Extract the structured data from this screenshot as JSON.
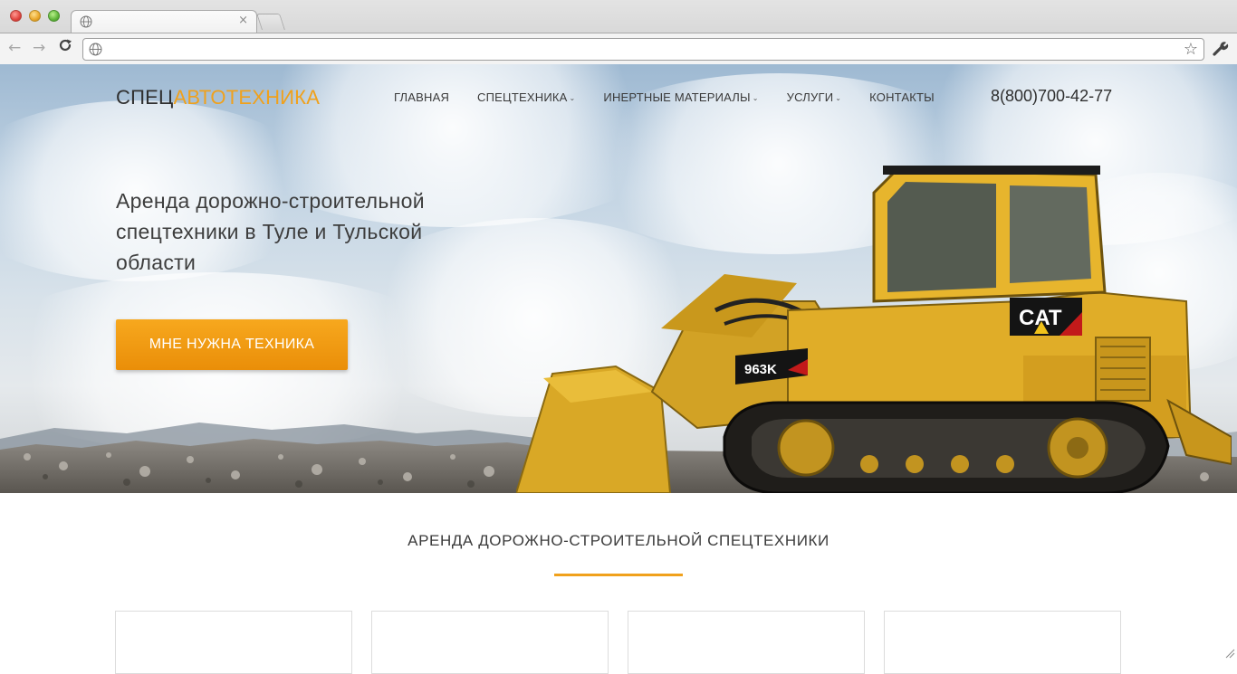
{
  "browser": {
    "tab_close": "×",
    "url_value": "",
    "back": "←",
    "forward": "→",
    "reload": "C",
    "bookmark": "☆"
  },
  "site": {
    "logo_part1": "СПЕЦ",
    "logo_part2": "АВТОТЕХНИКА",
    "accent_color": "#f0a11c",
    "menu": [
      {
        "label": "ГЛАВНАЯ",
        "has_dropdown": false
      },
      {
        "label": "СПЕЦТЕХНИКА",
        "has_dropdown": true
      },
      {
        "label": "ИНЕРТНЫЕ МАТЕРИАЛЫ",
        "has_dropdown": true
      },
      {
        "label": "УСЛУГИ",
        "has_dropdown": true
      },
      {
        "label": "КОНТАКТЫ",
        "has_dropdown": false
      }
    ],
    "caret": "⌄",
    "phone": "8(800)700-42-77"
  },
  "hero": {
    "title": "Аренда дорожно-строительной спецтехники в Туле и Тульской области",
    "cta_label": "МНЕ НУЖНА ТЕХНИКА",
    "machine_brand": "CAT",
    "machine_model": "963K"
  },
  "section": {
    "title": "АРЕНДА ДОРОЖНО-СТРОИТЕЛЬНОЙ СПЕЦТЕХНИКИ"
  }
}
